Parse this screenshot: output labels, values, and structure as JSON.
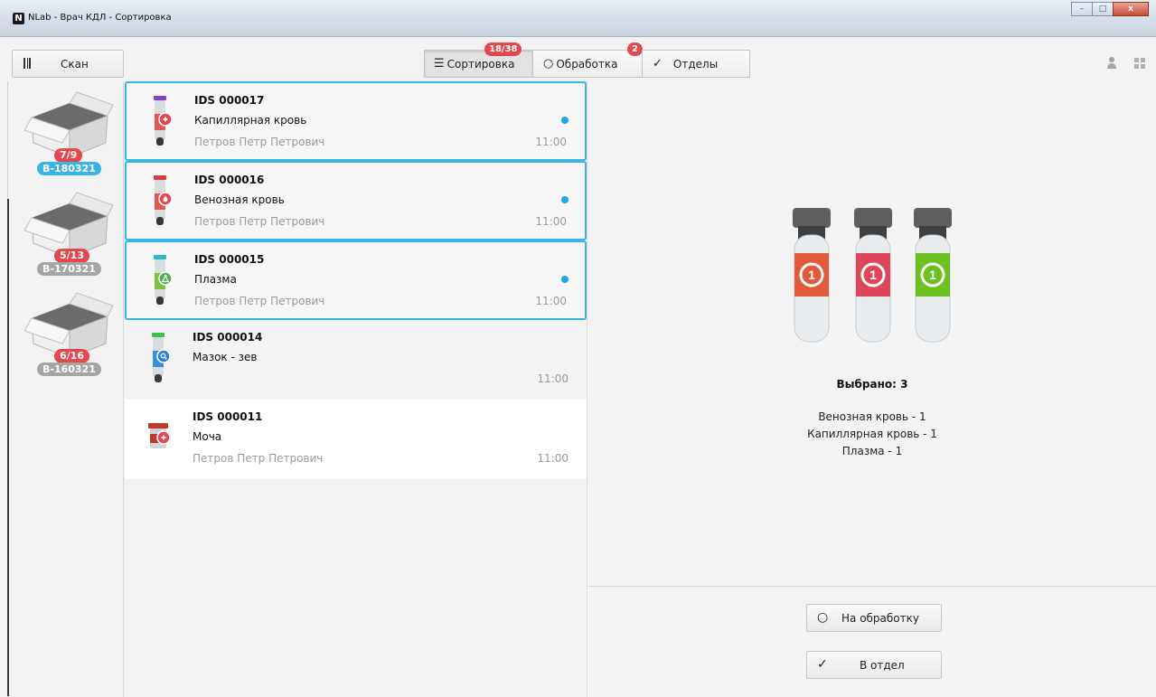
{
  "window": {
    "app_logo": "N",
    "title": "NLab - Врач КДЛ - Сортировка",
    "controls": {
      "minimize": "–",
      "maximize": "□",
      "close": "x"
    }
  },
  "toolbar": {
    "scan_label": "Скан",
    "tabs": [
      {
        "label": "Сортировка",
        "icon": "menu-icon",
        "badge": "18/38"
      },
      {
        "label": "Обработка",
        "icon": "circle-icon",
        "badge": "2"
      },
      {
        "label": "Отделы",
        "icon": "checkmark-icon",
        "badge": ""
      }
    ]
  },
  "boxes": [
    {
      "count": "7/9",
      "code": "B-180321"
    },
    {
      "count": "5/13",
      "code": "B-170321"
    },
    {
      "count": "6/16",
      "code": "B-160321"
    }
  ],
  "samples": [
    {
      "id": "IDS 000017",
      "type": "Капиллярная кровь",
      "person": "Петров Петр Петрович",
      "time": "11:00",
      "cap_color": "#8a3fc9",
      "tube_color": "#e05a55",
      "badge_color": "#e5474e"
    },
    {
      "id": "IDS 000016",
      "type": "Венозная кровь",
      "person": "Петров Петр Петрович",
      "time": "11:00",
      "cap_color": "#d93a3a",
      "tube_color": "#e05a55",
      "badge_color": "#e5474e"
    },
    {
      "id": "IDS 000015",
      "type": "Плазма",
      "person": "Петров Петр Петрович",
      "time": "11:00",
      "cap_color": "#2fb4c8",
      "tube_color": "#7cc242",
      "badge_color": "#4caf50"
    },
    {
      "id": "IDS 000014",
      "type": "Мазок - зев",
      "person": "",
      "time": "11:00",
      "cap_color": "#3cc04a",
      "tube_color": "#3a8fe0",
      "badge_color": "#2b7fd4"
    },
    {
      "id": "IDS 000011",
      "type": "Моча",
      "person": "Петров Петр Петрович",
      "time": "11:00",
      "cap_color": "#c0392b",
      "tube_color": "#c0392b",
      "badge_color": "#e5474e"
    }
  ],
  "detail": {
    "tube_colors": [
      "#e35a3a",
      "#e0465a",
      "#6cc020"
    ],
    "tube_number": "1",
    "selected_label": "Выбрано: 3",
    "summary": [
      "Венозная кровь - 1",
      "Капиллярная кровь - 1",
      "Плазма - 1"
    ]
  },
  "actions": {
    "process_label": "На обработку",
    "department_label": "В отдел"
  },
  "colors": {
    "accent": "#3ab4e8",
    "badge": "#e5474e",
    "dot": "#17a9e6"
  }
}
